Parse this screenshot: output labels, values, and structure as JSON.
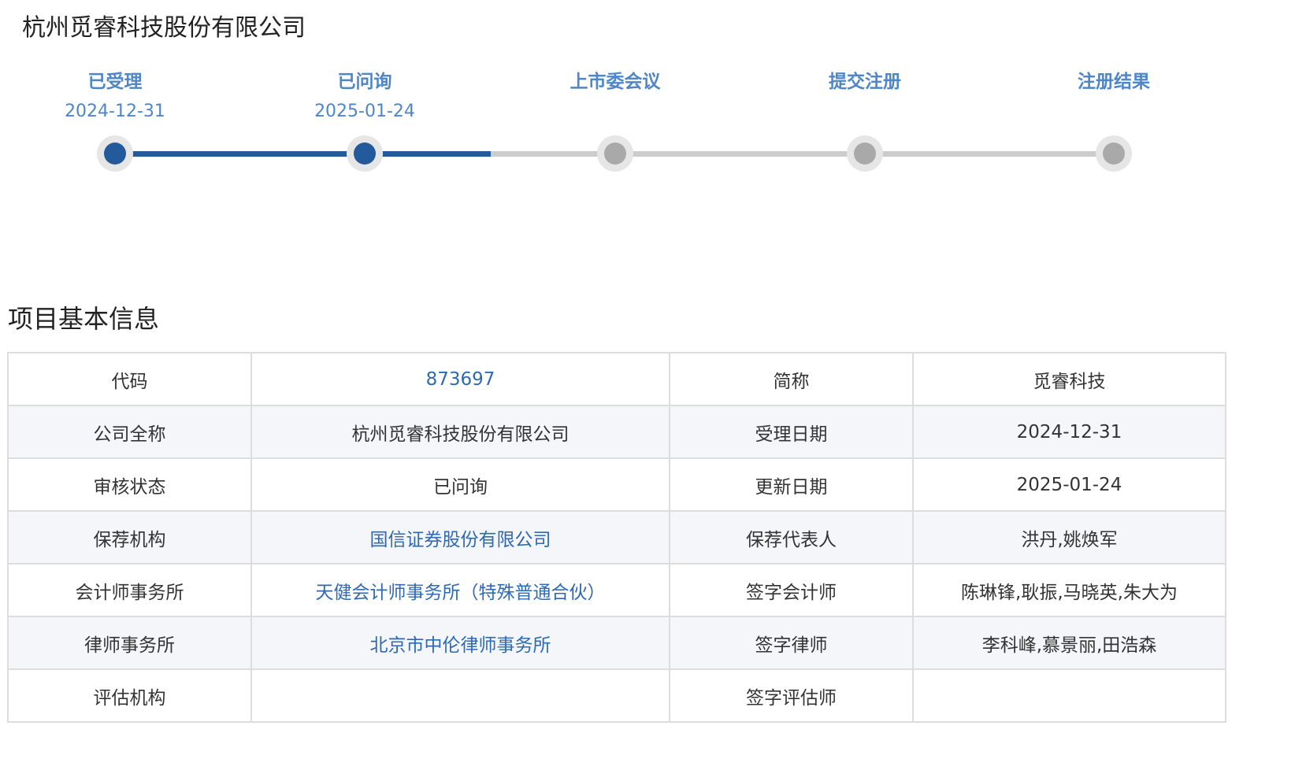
{
  "company": {
    "title": "杭州觅睿科技股份有限公司"
  },
  "colors": {
    "accent": "#225a9c",
    "link": "#2e6ab3",
    "step_label": "#4e86c8",
    "inactive": "#a9a9a9",
    "track_inactive": "#cccccc"
  },
  "progress": {
    "steps": [
      {
        "label": "已受理",
        "date": "2024-12-31",
        "status": "done"
      },
      {
        "label": "已问询",
        "date": "2025-01-24",
        "status": "current"
      },
      {
        "label": "上市委会议",
        "date": "",
        "status": "pending"
      },
      {
        "label": "提交注册",
        "date": "",
        "status": "pending"
      },
      {
        "label": "注册结果",
        "date": "",
        "status": "pending"
      }
    ]
  },
  "info": {
    "title": "项目基本信息",
    "rows": [
      {
        "k1": "代码",
        "v1": "873697",
        "v1_link": true,
        "k2": "简称",
        "v2": "觅睿科技"
      },
      {
        "k1": "公司全称",
        "v1": "杭州觅睿科技股份有限公司",
        "v1_link": false,
        "k2": "受理日期",
        "v2": "2024-12-31"
      },
      {
        "k1": "审核状态",
        "v1": "已问询",
        "v1_link": false,
        "k2": "更新日期",
        "v2": "2025-01-24"
      },
      {
        "k1": "保荐机构",
        "v1": "国信证券股份有限公司",
        "v1_link": true,
        "k2": "保荐代表人",
        "v2": "洪丹,姚焕军"
      },
      {
        "k1": "会计师事务所",
        "v1": "天健会计师事务所（特殊普通合伙）",
        "v1_link": true,
        "k2": "签字会计师",
        "v2": "陈琳锋,耿振,马晓英,朱大为"
      },
      {
        "k1": "律师事务所",
        "v1": "北京市中伦律师事务所",
        "v1_link": true,
        "k2": "签字律师",
        "v2": "李科峰,慕景丽,田浩森"
      },
      {
        "k1": "评估机构",
        "v1": "",
        "v1_link": false,
        "k2": "签字评估师",
        "v2": ""
      }
    ]
  }
}
